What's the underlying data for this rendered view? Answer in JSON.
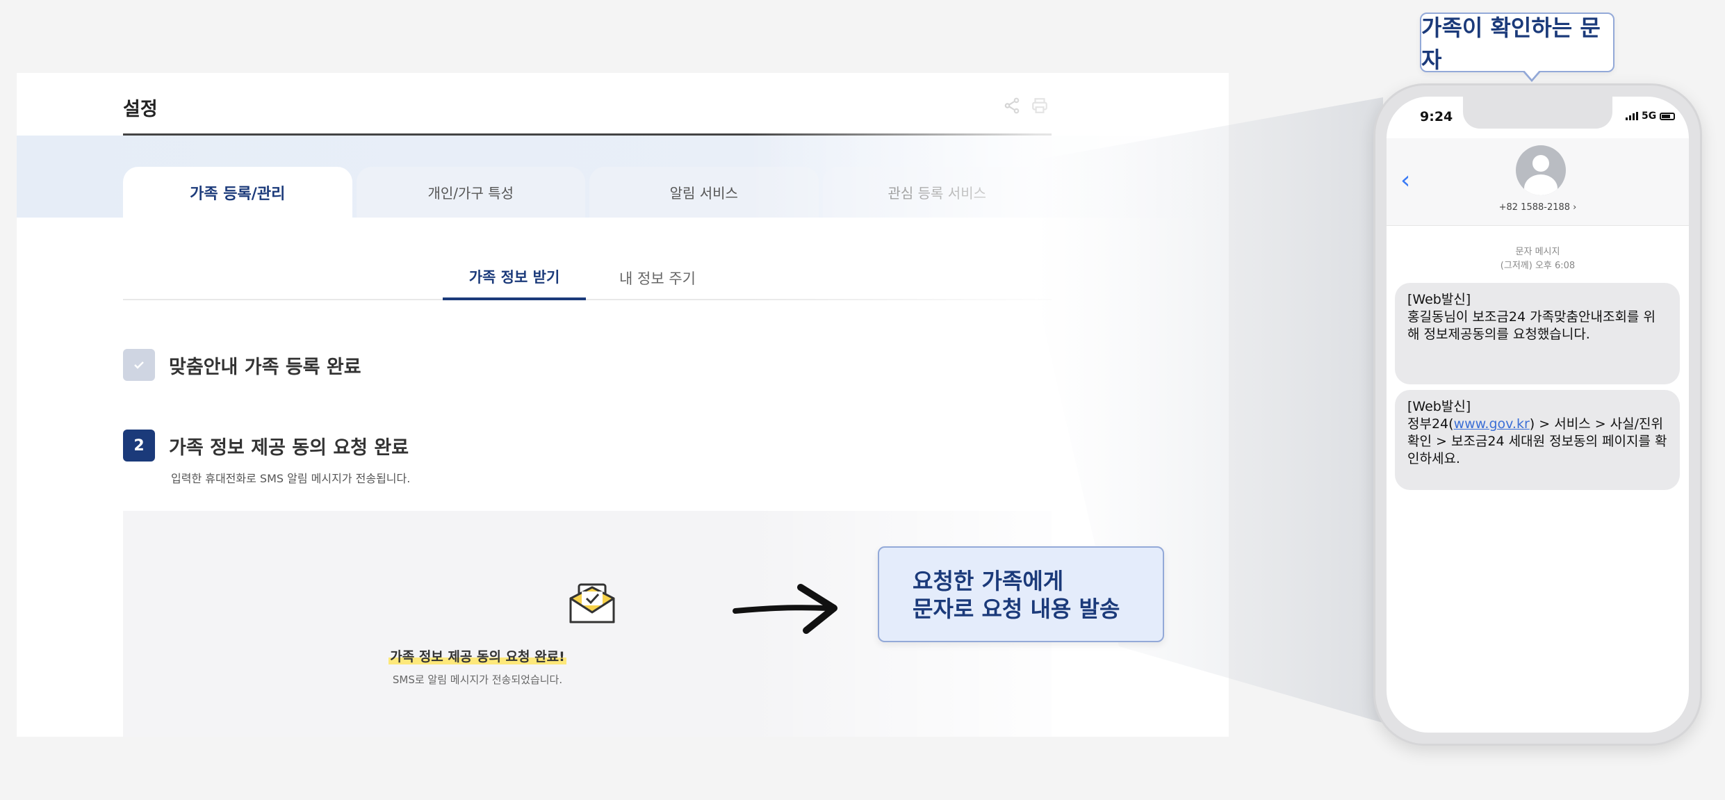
{
  "web": {
    "title": "설정",
    "tabs": [
      "가족 등록/관리",
      "개인/가구 특성",
      "알림 서비스",
      "관심 등록 서비스"
    ],
    "subtabs": [
      "가족 정보 받기",
      "내 정보 주기"
    ],
    "step1": {
      "text": "맞춤안내 가족 등록 완료"
    },
    "step2": {
      "number": "2",
      "text": "가족 정보 제공 동의 요청 완료",
      "desc": "입력한 휴대전화로 SMS 알림 메시지가 전송됩니다."
    },
    "result": {
      "title": "가족 정보 제공 동의 요청 완료!",
      "sub": "SMS로 알림 메시지가 전송되었습니다."
    }
  },
  "callout": {
    "line1": "요청한 가족에게",
    "line2": "문자로 요청 내용 발송"
  },
  "phone": {
    "label": "가족이 확인하는 문자",
    "time": "9:24",
    "network": "5G",
    "contact": "+82 1588-2188 ›",
    "meta1": "문자 메시지",
    "meta2": "(그저께) 오후 6:08",
    "msg1": "[Web발신]\n홍길동님이 보조금24 가족맞춤안내조회를 위해 정보제공동의를 요청했습니다.",
    "msg2_prefix": "[Web발신]\n정부24(",
    "msg2_link": "www.gov.kr",
    "msg2_suffix": ") > 서비스 > 사실/진위확인 > 보조금24 세대원 정보동의 페이지를 확인하세요."
  },
  "colors": {
    "navy": "#1b3a7a",
    "callout_bg": "#e4ecfb",
    "callout_border": "#93a9d8",
    "highlight": "#fde87a"
  }
}
